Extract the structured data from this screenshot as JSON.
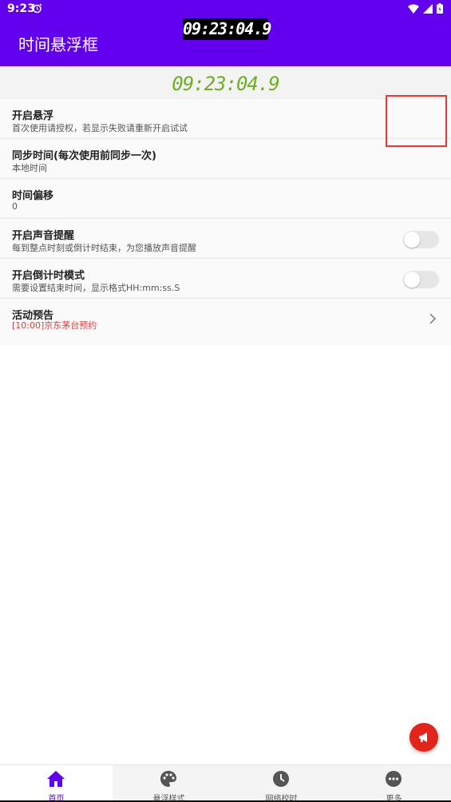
{
  "status_bar": {
    "time": "9:23"
  },
  "app_bar": {
    "title": "时间悬浮框"
  },
  "floating_clock": {
    "time": "09:23:04.9"
  },
  "main_clock": {
    "time": "09:23:04.9"
  },
  "settings": [
    {
      "title": "开启悬浮",
      "subtitle": "首次使用请授权，若显示失败请重新开启试试",
      "toggle": true
    },
    {
      "title": "同步时间(每次使用前同步一次)",
      "subtitle": "本地时间"
    },
    {
      "title": "时间偏移",
      "subtitle": "0"
    },
    {
      "title": "开启声音提醒",
      "subtitle": "每到整点时刻或倒计时结束，为您播放声音提醒",
      "toggle": false
    },
    {
      "title": "开启倒计时模式",
      "subtitle": "需要设置结束时间，显示格式HH:mm:ss.S",
      "toggle": false
    },
    {
      "title": "活动预告",
      "subtitle": "[10:00]京东茅台预约"
    }
  ],
  "bottom_nav": [
    {
      "label": "首页",
      "icon": "home-icon",
      "active": true
    },
    {
      "label": "悬浮样式",
      "icon": "palette-icon",
      "active": false
    },
    {
      "label": "网络校时",
      "icon": "clock-icon",
      "active": false
    },
    {
      "label": "更多",
      "icon": "more-icon",
      "active": false
    }
  ],
  "colors": {
    "primary": "#6200ee",
    "toggle_on": "#7fd17f",
    "clock_green": "#6fae22",
    "fab_red": "#e3241b",
    "highlight": "#e53935"
  }
}
